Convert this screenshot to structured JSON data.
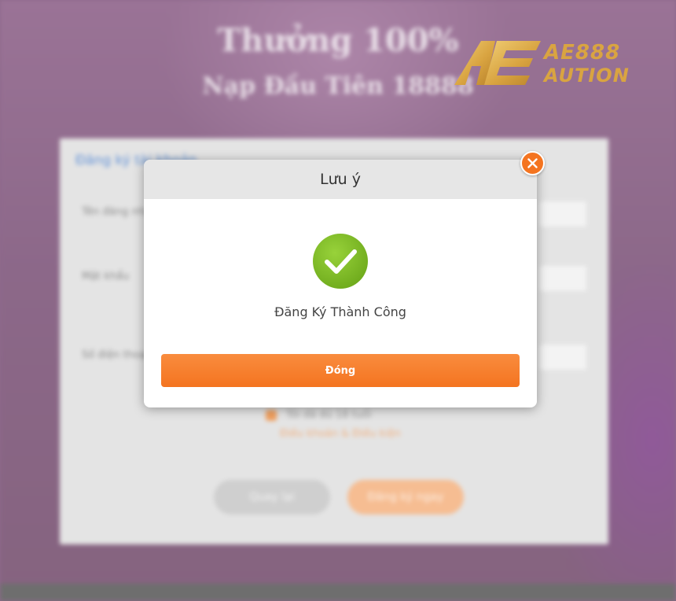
{
  "background": {
    "promo_line_1": "Thưởng 100%",
    "promo_line_2": "Nạp Đầu Tiên 18888",
    "form_card": {
      "title": "Đăng ký tài khoản",
      "field_labels": [
        "Tên đăng nhập",
        "Mật khẩu",
        "Số điện thoại"
      ],
      "agree_text": "Tôi đã đủ 18 tuổi",
      "terms_link": "Điều khoản & Điều kiện",
      "back_button": "Quay lại",
      "register_button": "Đăng ký ngay"
    }
  },
  "logo": {
    "line_1": "AE888",
    "line_2": "AUTION",
    "gold_color": "#d9a441"
  },
  "modal": {
    "title": "Lưu ý",
    "icon": "check-circle-icon",
    "message": "Đăng Ký Thành Công",
    "confirm_button": "Đóng",
    "close_icon": "close-icon"
  },
  "colors": {
    "accent": "#f47420",
    "success": "#7cba23",
    "header_bg": "#e6e6e6"
  }
}
